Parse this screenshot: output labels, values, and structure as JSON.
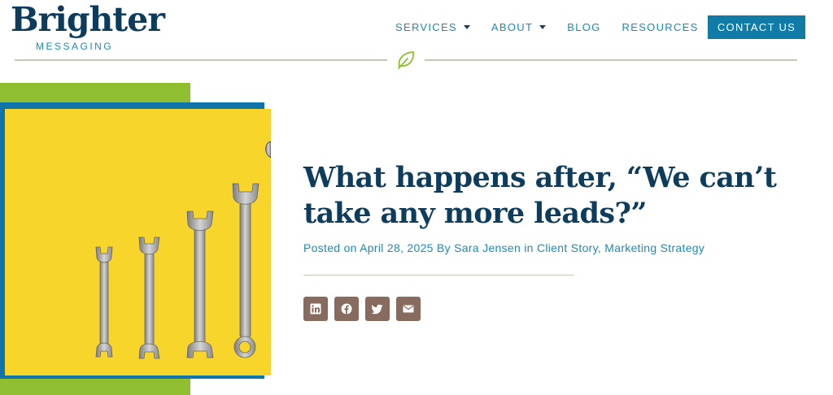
{
  "logo": {
    "name": "Brighter",
    "tagline": "MESSAGING"
  },
  "nav": {
    "items": [
      {
        "label": "SERVICES",
        "has_dropdown": true
      },
      {
        "label": "ABOUT",
        "has_dropdown": true
      },
      {
        "label": "BLOG",
        "has_dropdown": false
      },
      {
        "label": "RESOURCES",
        "has_dropdown": false
      }
    ],
    "cta_label": "CONTACT US"
  },
  "divider": {
    "icon": "leaf-icon"
  },
  "hero_image": {
    "icon": "wrenches-photo"
  },
  "article": {
    "title": "What happens after, “We can’t take any more leads?”",
    "meta": {
      "posted_on": "Posted on",
      "date": "April 28, 2025",
      "by": "By",
      "author": "Sara Jensen",
      "in": "in",
      "category_1": "Client Story",
      "separator": ",",
      "category_2": "Marketing Strategy"
    },
    "share": [
      {
        "icon": "linkedin-icon"
      },
      {
        "icon": "facebook-icon"
      },
      {
        "icon": "twitter-icon"
      },
      {
        "icon": "email-icon"
      }
    ]
  },
  "colors": {
    "brand_navy": "#0e3c5c",
    "link_blue": "#1a8ab5",
    "button_blue": "#117ba8",
    "accent_green": "#8fbe30",
    "accent_blue": "#0e74aa",
    "photo_yellow": "#f7d52b",
    "share_brown": "#876b5e"
  }
}
